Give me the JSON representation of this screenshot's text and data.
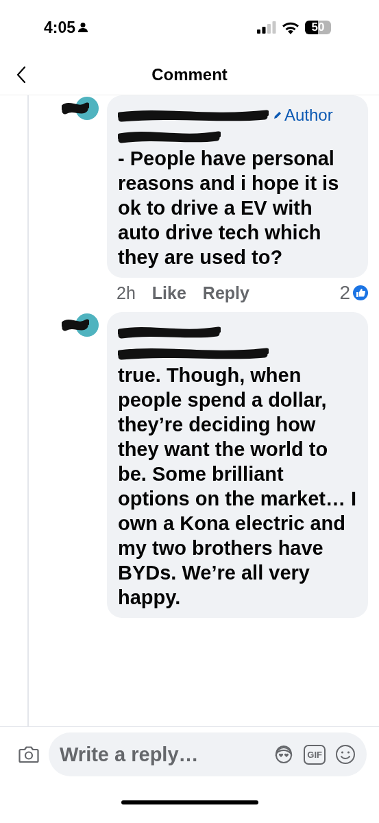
{
  "status_bar": {
    "time": "4:05",
    "battery": "50"
  },
  "header": {
    "title": "Comment"
  },
  "comments": [
    {
      "author_badge": "Author",
      "text": "- People have personal reasons and i hope it is ok to drive a EV with auto drive tech which they are used to?",
      "time": "2h",
      "actions": [
        "Like",
        "Reply"
      ],
      "reaction_count": "2"
    },
    {
      "text": "true. Though, when people spend a dollar, they’re deciding how they want the world to be. Some brilliant options on the market… I own a Kona electric and my two brothers have BYDs. We’re all very happy."
    }
  ],
  "composer": {
    "placeholder": "Write a reply…",
    "gif_label": "GIF"
  }
}
